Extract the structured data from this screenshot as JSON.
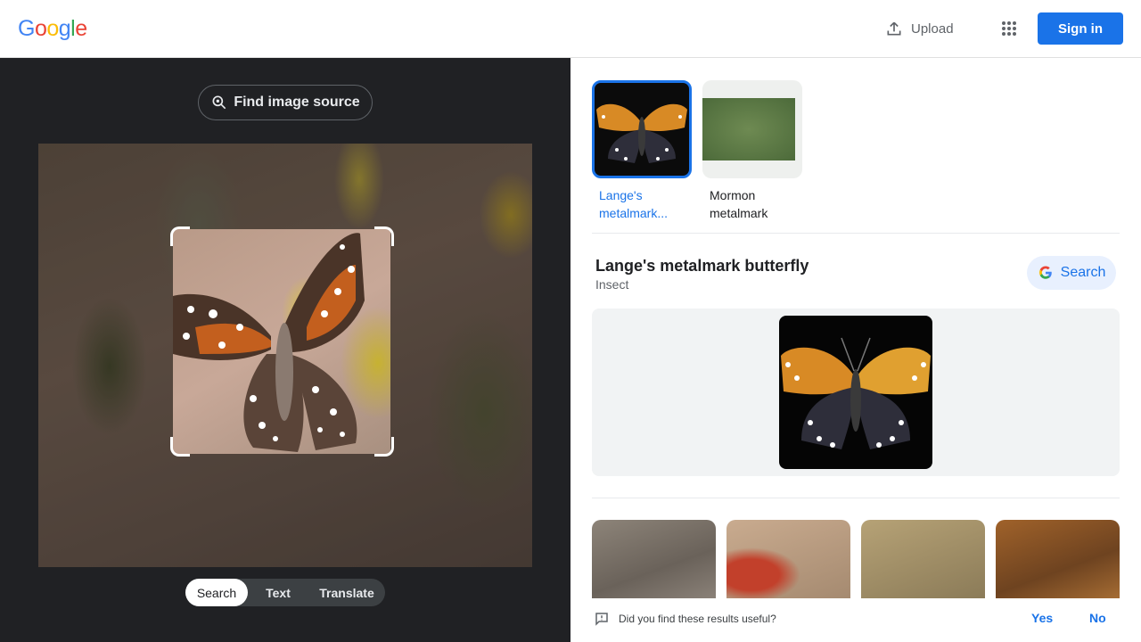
{
  "header": {
    "logo_letters": [
      {
        "ch": "G",
        "color": "#4285F4"
      },
      {
        "ch": "o",
        "color": "#EA4335"
      },
      {
        "ch": "o",
        "color": "#FBBC05"
      },
      {
        "ch": "g",
        "color": "#4285F4"
      },
      {
        "ch": "l",
        "color": "#34A853"
      },
      {
        "ch": "e",
        "color": "#EA4335"
      }
    ],
    "upload_label": "Upload",
    "signin_label": "Sign in"
  },
  "left": {
    "find_source_label": "Find image source",
    "modes": [
      "Search",
      "Text",
      "Translate"
    ],
    "active_mode": "Search"
  },
  "right": {
    "chips": [
      {
        "label": "Lange's metalmark...",
        "selected": true
      },
      {
        "label": "Mormon metalmark",
        "selected": false
      }
    ],
    "entity": {
      "title": "Lange's metalmark butterfly",
      "subtitle": "Insect",
      "search_label": "Search"
    },
    "feedback": {
      "question": "Did you find these results useful?",
      "yes": "Yes",
      "no": "No"
    }
  },
  "colors": {
    "accent": "#1a73e8",
    "dark_panel": "#202124"
  }
}
